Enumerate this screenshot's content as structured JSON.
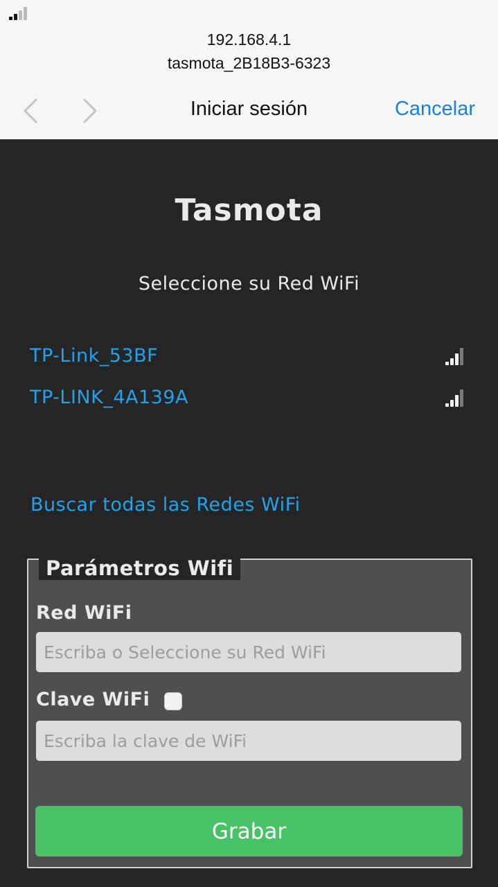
{
  "status_bar": {
    "icon": "cellular-signal-icon"
  },
  "browser": {
    "host": "192.168.4.1",
    "ssid": "tasmota_2B18B3-6323",
    "back_icon": "chevron-left-icon",
    "forward_icon": "chevron-right-icon",
    "title": "Iniciar sesión",
    "cancel_label": "Cancelar"
  },
  "page": {
    "title": "Tasmota",
    "subtitle": "Seleccione su Red WiFi",
    "networks": [
      {
        "name": "TP-Link_53BF",
        "signal_icon": "wifi-signal-bars-icon",
        "signal_level": 3,
        "signal_max": 4
      },
      {
        "name": "TP-LINK_4A139A",
        "signal_icon": "wifi-signal-bars-icon",
        "signal_level": 3,
        "signal_max": 4
      }
    ],
    "scan_all_label": "Buscar todas las Redes WiFi"
  },
  "form": {
    "legend": "Parámetros Wifi",
    "ssid_label": "Red WiFi",
    "ssid_value": "",
    "ssid_placeholder": "Escriba o Seleccione su Red WiFi",
    "password_label": "Clave WiFi",
    "show_password_checked": false,
    "password_value": "",
    "password_placeholder": "Escriba la clave de WiFi",
    "save_label": "Grabar"
  },
  "colors": {
    "background": "#252525",
    "link": "#1fa3ec",
    "button": "#47c266",
    "ios_accent": "#1b7ee3",
    "fieldset_bg": "#4f4f4f"
  }
}
